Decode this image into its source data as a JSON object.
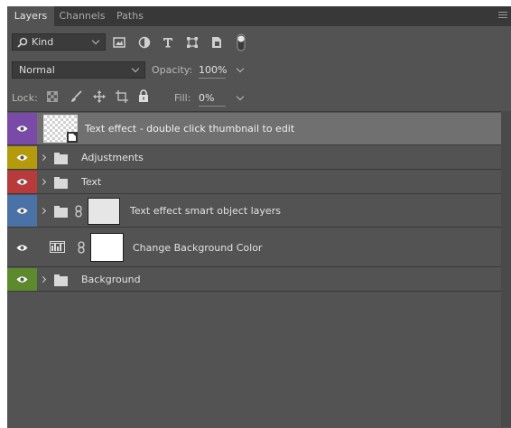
{
  "tabs": [
    {
      "label": "Layers",
      "active": true
    },
    {
      "label": "Channels",
      "active": false
    },
    {
      "label": "Paths",
      "active": false
    }
  ],
  "filter": {
    "kind_label": "Kind",
    "icons": [
      "image-filter-icon",
      "adjustment-filter-icon",
      "type-filter-icon",
      "shape-filter-icon",
      "smart-object-filter-icon",
      "filter-toggle-icon"
    ]
  },
  "blend": {
    "mode": "Normal",
    "opacity_label": "Opacity:",
    "opacity_value": "100%"
  },
  "lock": {
    "label": "Lock:",
    "fill_label": "Fill:",
    "fill_value": "0%",
    "icons": [
      "lock-transparent-icon",
      "lock-brush-icon",
      "lock-move-icon",
      "lock-artboard-icon",
      "lock-all-icon"
    ]
  },
  "layers": [
    {
      "name": "Text effect - double click thumbnail to edit",
      "color": "#7a4aa8",
      "selected": true
    },
    {
      "name": "Adjustments",
      "color": "#b59a0c"
    },
    {
      "name": "Text",
      "color": "#b83a3a"
    },
    {
      "name": "Text effect smart object layers",
      "color": "#4a72a6"
    },
    {
      "name": "Change Background Color",
      "color": "#535353"
    },
    {
      "name": "Background",
      "color": "#5e8a2e"
    }
  ],
  "colors": {
    "panel": "#535353",
    "tabbar": "#383838",
    "selected_row": "#707070"
  }
}
